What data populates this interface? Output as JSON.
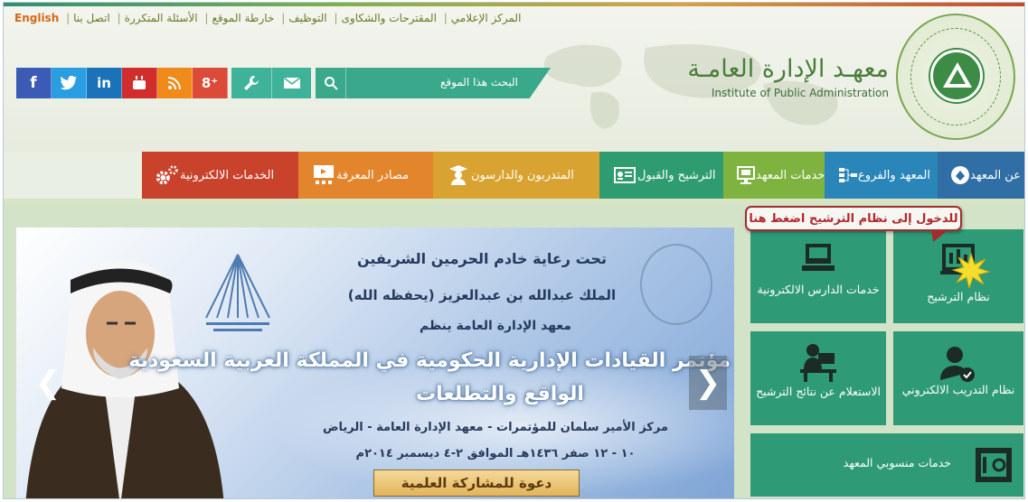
{
  "top_links": [
    "English",
    "اتصل بنا",
    "الأسئلة المتكررة",
    "خارطة الموقع",
    "التوظيف",
    "المقترحات والشكاوى",
    "المركز الإعلامي"
  ],
  "search": {
    "placeholder": "البحث هذا الموقع"
  },
  "social": [
    {
      "icon": "facebook-icon",
      "glyph": "f",
      "color": "#3b5bb5"
    },
    {
      "icon": "twitter-icon",
      "glyph": "🐦",
      "color": "#2a9ee0"
    },
    {
      "icon": "linkedin-icon",
      "glyph": "in",
      "color": "#1c72b8"
    },
    {
      "icon": "youtube-icon",
      "glyph": "▶",
      "color": "#d22d2d"
    },
    {
      "icon": "rss-icon",
      "glyph": "◝",
      "color": "#f08a1a"
    },
    {
      "icon": "googleplus-icon",
      "glyph": "g+",
      "color": "#dc4a38"
    }
  ],
  "logo": {
    "arabic": "معهـد الإدارة العامـة",
    "english": "Institute of Public Administration"
  },
  "nav": [
    {
      "label": "عن المعهد",
      "icon": "info-icon",
      "color": "#2f6fa6"
    },
    {
      "label": "المعهد والفروع",
      "icon": "org-chart-icon",
      "color": "#2a86b8"
    },
    {
      "label": "خدمات المعهد",
      "icon": "services-icon",
      "color": "#7db33e"
    },
    {
      "label": "الترشيح والقبول",
      "icon": "id-card-icon",
      "color": "#2f9c6f"
    },
    {
      "label": "المتدربون والدارسون",
      "icon": "student-icon",
      "color": "#d9a332"
    },
    {
      "label": "مصادر المعرفة",
      "icon": "presentation-icon",
      "color": "#e3852d"
    },
    {
      "label": "الخدمات الالكترونية",
      "icon": "gears-icon",
      "color": "#c9432c"
    }
  ],
  "slider": {
    "line1": "تحت رعاية خادم الحرمين الشريفين",
    "line2": "الملك عبدالله بن عبدالعزيز   (يحفظه الله)",
    "line3": "معهد الإدارة العامة ينظم",
    "line4": "مؤتمر القيادات الإدارية الحكومية في المملكة العربية السعودية",
    "line5": "الواقع والتطلعات",
    "line6": "مركز الأمير سلمان للمؤتمرات - معهد الإدارة العامة - الرياض",
    "line7": "١٠ - ١٢ صفر ١٤٣٦هـ الموافق ٢-٤ ديسمبر ٢٠١٤م",
    "cta": "دعوة للمشاركة العلمية"
  },
  "tiles": {
    "nomination": "نظام الترشيح",
    "student_services": "خدمات الدارس الالكترونية",
    "e_training": "نظام التدريب الالكتروني",
    "results": "الاستعلام عن نتائج الترشيح",
    "staff": "خدمات منسوبي المعهد"
  },
  "tooltip": "للدخول إلى نظام الترشيح اضغط هنا",
  "colors": {
    "tile": "#2e9a76",
    "tooltip_border": "#a32d2d"
  }
}
